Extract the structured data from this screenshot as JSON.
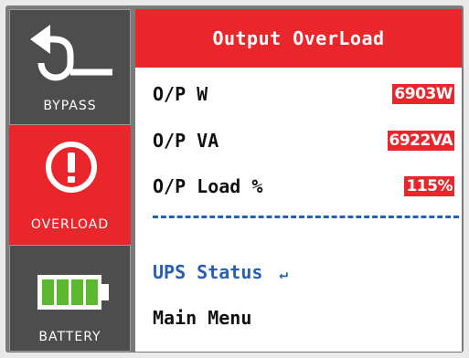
{
  "sidebar": {
    "items": [
      {
        "label": "BYPASS",
        "icon": "bypass-arrow-icon",
        "active": false
      },
      {
        "label": "OVERLOAD",
        "icon": "alert-circle-icon",
        "active": true
      },
      {
        "label": "BATTERY",
        "icon": "battery-full-icon",
        "active": false
      }
    ]
  },
  "panel": {
    "title": "Output OverLoad",
    "readings": [
      {
        "label": "O/P W",
        "value": "6903W"
      },
      {
        "label": "O/P VA",
        "value": "6922VA"
      },
      {
        "label": "O/P Load %",
        "value": "115%"
      }
    ],
    "menu": [
      {
        "label": "UPS Status",
        "selected": true,
        "enter_symbol": "↵"
      },
      {
        "label": "Main Menu",
        "selected": false
      }
    ]
  },
  "colors": {
    "accent_red": "#e8262c",
    "tile_dark": "#4d4d4d",
    "selected_blue": "#2a5fb0",
    "battery_green": "#5cb82e"
  }
}
